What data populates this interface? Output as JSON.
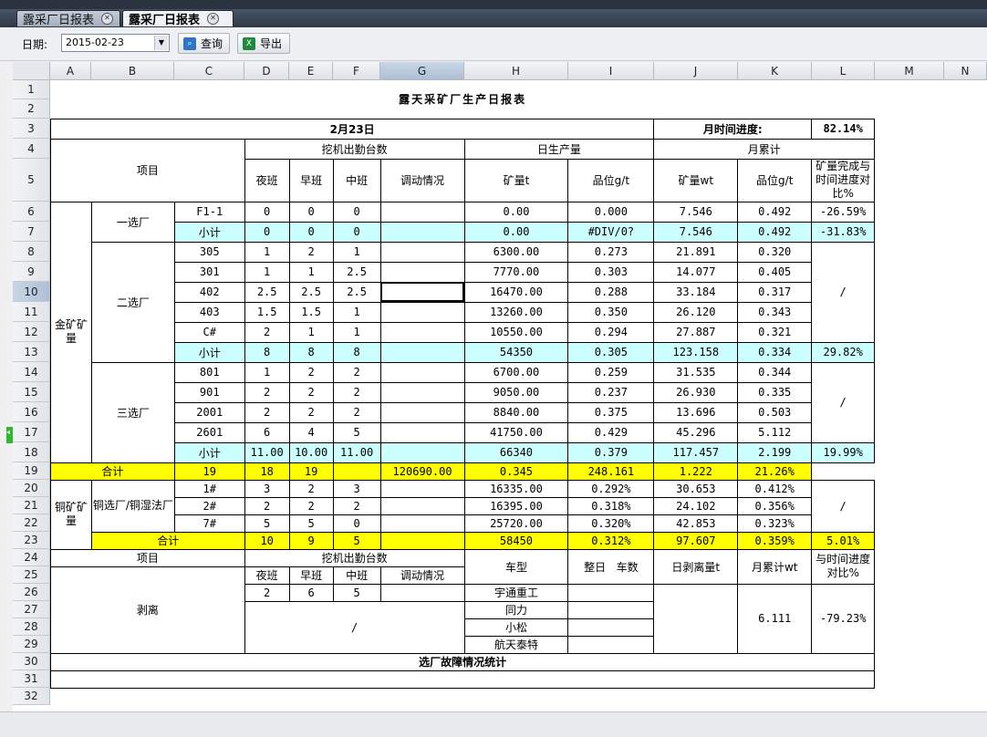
{
  "tabs": [
    {
      "label": "露采厂日报表"
    },
    {
      "label": "露采厂日报表"
    }
  ],
  "toolbar": {
    "date_label": "日期:",
    "date_value": "2015-02-23",
    "query_label": "查询",
    "export_label": "导出"
  },
  "columns": [
    "A",
    "B",
    "C",
    "D",
    "E",
    "F",
    "G",
    "H",
    "I",
    "J",
    "K",
    "L",
    "M",
    "N"
  ],
  "rows": [
    "1",
    "2",
    "3",
    "4",
    "5",
    "6",
    "7",
    "8",
    "9",
    "10",
    "11",
    "12",
    "13",
    "14",
    "15",
    "16",
    "17",
    "18",
    "19",
    "20",
    "21",
    "22",
    "23",
    "24",
    "25",
    "26",
    "27",
    "28",
    "29",
    "30",
    "31",
    "32"
  ],
  "colors": {
    "subtotal": "#ccffff",
    "total": "#ffff00",
    "selected_header": "#c9d6e7"
  },
  "report": {
    "title": "露天采矿厂生产日报表",
    "date": "2月23日",
    "time_progress_label": "月时间进度:",
    "time_progress": "82.14%",
    "hdr": {
      "excavator": "挖机出勤台数",
      "daily": "日生产量",
      "monthly": "月累计",
      "item": "项目",
      "night": "夜班",
      "early": "早班",
      "middle": "中班",
      "dispatch": "调动情况",
      "ore_t": "矿量t",
      "grade": "品位g/t",
      "ore_wt": "矿量wt",
      "grade2": "品位g/t",
      "ratio": "矿量完成与时间进度对比%"
    },
    "gold": "金矿矿量",
    "plant1": "一选厂",
    "plant2": "二选厂",
    "plant3": "三选厂",
    "subtotal": "小计",
    "total": "合计",
    "slash": "/",
    "r6": [
      "F1-1",
      "0",
      "0",
      "0",
      "",
      "0.00",
      "0.000",
      "7.546",
      "0.492",
      "-26.59%"
    ],
    "r7": [
      "0",
      "0",
      "0",
      "",
      "0.00",
      "#DIV/0?",
      "7.546",
      "0.492",
      "-31.83%"
    ],
    "r8": [
      "305",
      "1",
      "2",
      "1",
      "",
      "6300.00",
      "0.273",
      "21.891",
      "0.320"
    ],
    "r9": [
      "301",
      "1",
      "1",
      "2.5",
      "",
      "7770.00",
      "0.303",
      "14.077",
      "0.405"
    ],
    "r10": [
      "402",
      "2.5",
      "2.5",
      "2.5",
      "",
      "16470.00",
      "0.288",
      "33.184",
      "0.317"
    ],
    "r11": [
      "403",
      "1.5",
      "1.5",
      "1",
      "",
      "13260.00",
      "0.350",
      "26.120",
      "0.343"
    ],
    "r12": [
      "C#",
      "2",
      "1",
      "1",
      "",
      "10550.00",
      "0.294",
      "27.887",
      "0.321"
    ],
    "r13": [
      "8",
      "8",
      "8",
      "",
      "54350",
      "0.305",
      "123.158",
      "0.334",
      "29.82%"
    ],
    "r14": [
      "801",
      "1",
      "2",
      "2",
      "",
      "6700.00",
      "0.259",
      "31.535",
      "0.344"
    ],
    "r15": [
      "901",
      "2",
      "2",
      "2",
      "",
      "9050.00",
      "0.237",
      "26.930",
      "0.335"
    ],
    "r16": [
      "2001",
      "2",
      "2",
      "2",
      "",
      "8840.00",
      "0.375",
      "13.696",
      "0.503"
    ],
    "r17": [
      "2601",
      "6",
      "4",
      "5",
      "",
      "41750.00",
      "0.429",
      "45.296",
      "5.112"
    ],
    "r18": [
      "11.00",
      "10.00",
      "11.00",
      "",
      "66340",
      "0.379",
      "117.457",
      "2.199",
      "19.99%"
    ],
    "r19": [
      "19",
      "18",
      "19",
      "",
      "120690.00",
      "0.345",
      "248.161",
      "1.222",
      "21.26%"
    ],
    "copper": "铜矿矿量",
    "plant4": "铜选厂/铜湿法厂",
    "r20": [
      "1#",
      "3",
      "2",
      "3",
      "",
      "16335.00",
      "0.292%",
      "30.653",
      "0.412%"
    ],
    "r21": [
      "2#",
      "2",
      "2",
      "2",
      "",
      "16395.00",
      "0.318%",
      "24.102",
      "0.356%"
    ],
    "r22": [
      "7#",
      "5",
      "5",
      "0",
      "",
      "25720.00",
      "0.320%",
      "42.853",
      "0.323%"
    ],
    "r23": [
      "10",
      "9",
      "5",
      "",
      "58450",
      "0.312%",
      "97.607",
      "0.359%",
      "5.01%"
    ],
    "strip": {
      "item": "项目",
      "excavator": "挖机出勤台数",
      "night": "夜班",
      "early": "早班",
      "middle": "中班",
      "dispatch": "调动情况",
      "type": "车型",
      "days": "整日",
      "cars": "车数",
      "daily": "日剥离量t",
      "monthly": "月累计wt",
      "ratio": "与时间进度对比%",
      "name": "剥离",
      "vals": [
        "2",
        "6",
        "5"
      ],
      "types": [
        "宇通重工",
        "同力",
        "小松",
        "航天泰特"
      ],
      "monthly_val": "6.111",
      "ratio_val": "-79.23%"
    },
    "fault": "选厂故障情况统计"
  }
}
